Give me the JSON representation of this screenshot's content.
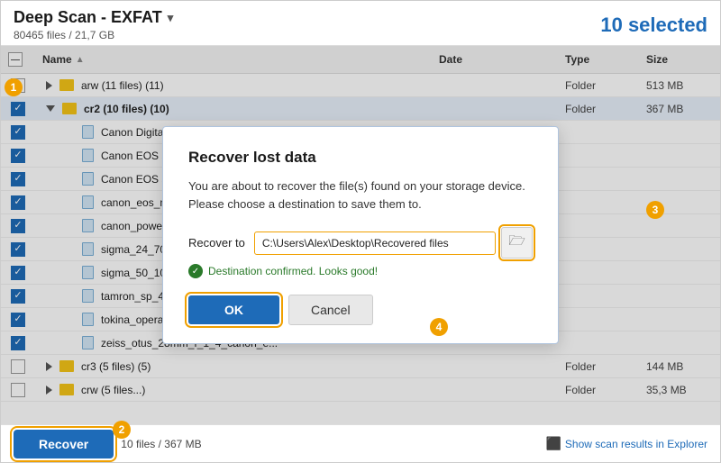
{
  "header": {
    "title": "Deep Scan - EXFAT",
    "subtitle": "80465 files / 21,7 GB",
    "selected_label": "10 selected",
    "dropdown_label": "Deep Scan - EXFAT"
  },
  "table": {
    "columns": [
      "Name",
      "Date",
      "Type",
      "Size"
    ],
    "rows": [
      {
        "id": 1,
        "indent": 1,
        "type": "folder",
        "name": "arw (11 files) (11)",
        "date": "",
        "file_type": "Folder",
        "size": "513 MB",
        "checked": false,
        "expanded": false
      },
      {
        "id": 2,
        "indent": 1,
        "type": "folder",
        "name": "cr2 (10 files) (10)",
        "date": "",
        "file_type": "Folder",
        "size": "367 MB",
        "checked": true,
        "expanded": true,
        "highlighted": true
      },
      {
        "id": 3,
        "indent": 2,
        "type": "file",
        "name": "Canon Digital Rebel XSi MG_112...",
        "date": "",
        "file_type": "",
        "size": "",
        "checked": true
      },
      {
        "id": 4,
        "indent": 2,
        "type": "file",
        "name": "Canon EOS 500D IMG_0002.CR2",
        "date": "",
        "file_type": "",
        "size": "",
        "checked": true
      },
      {
        "id": 5,
        "indent": 2,
        "type": "file",
        "name": "Canon EOS 5D Mark IV B13A07...",
        "date": "",
        "file_type": "",
        "size": "",
        "checked": true
      },
      {
        "id": 6,
        "indent": 2,
        "type": "file",
        "name": "canon_eos_m100_04.cr2",
        "date": "",
        "file_type": "",
        "size": "",
        "checked": true
      },
      {
        "id": 7,
        "indent": 2,
        "type": "file",
        "name": "canon_powershot_g9_x_mark_ii_...",
        "date": "",
        "file_type": "",
        "size": "",
        "checked": true
      },
      {
        "id": 8,
        "indent": 2,
        "type": "file",
        "name": "sigma_24_70mm_f2_8_dg_os_hs...",
        "date": "",
        "file_type": "",
        "size": "",
        "checked": true
      },
      {
        "id": 9,
        "indent": 2,
        "type": "file",
        "name": "sigma_50_100mm_f1_8_dc_hsm_...",
        "date": "",
        "file_type": "",
        "size": "",
        "checked": true
      },
      {
        "id": 10,
        "indent": 2,
        "type": "file",
        "name": "tamron_sp_45mm_f1_8_di_vc_us...",
        "date": "",
        "file_type": "",
        "size": "",
        "checked": true
      },
      {
        "id": 11,
        "indent": 2,
        "type": "file",
        "name": "tokina_opera_50mm_1_4_ff_19.c...",
        "date": "",
        "file_type": "",
        "size": "",
        "checked": true
      },
      {
        "id": 12,
        "indent": 2,
        "type": "file",
        "name": "zeiss_otus_28mm_f_1_4_canon_e...",
        "date": "",
        "file_type": "",
        "size": "",
        "checked": true
      },
      {
        "id": 13,
        "indent": 1,
        "type": "folder",
        "name": "cr3 (5 files) (5)",
        "date": "",
        "file_type": "Folder",
        "size": "144 MB",
        "checked": false,
        "expanded": false
      },
      {
        "id": 14,
        "indent": 1,
        "type": "folder",
        "name": "crw (5 files...)",
        "date": "",
        "file_type": "Folder",
        "size": "35,3 MB",
        "checked": false,
        "expanded": false
      }
    ]
  },
  "bottom_bar": {
    "recover_label": "Recover",
    "info_label": "10 files / 367 MB",
    "show_results_label": "Show scan results in Explorer"
  },
  "modal": {
    "title": "Recover lost data",
    "body": "You are about to recover the file(s) found on your storage device. Please choose a destination to save them to.",
    "recover_to_label": "Recover to",
    "path_value": "C:\\Users\\Alex\\Desktop\\Recovered files",
    "status_text": "Destination confirmed. Looks good!",
    "ok_label": "OK",
    "cancel_label": "Cancel",
    "browse_icon": "📁"
  },
  "annotations": {
    "badge1": "1",
    "badge2": "2",
    "badge3": "3",
    "badge4": "4"
  }
}
